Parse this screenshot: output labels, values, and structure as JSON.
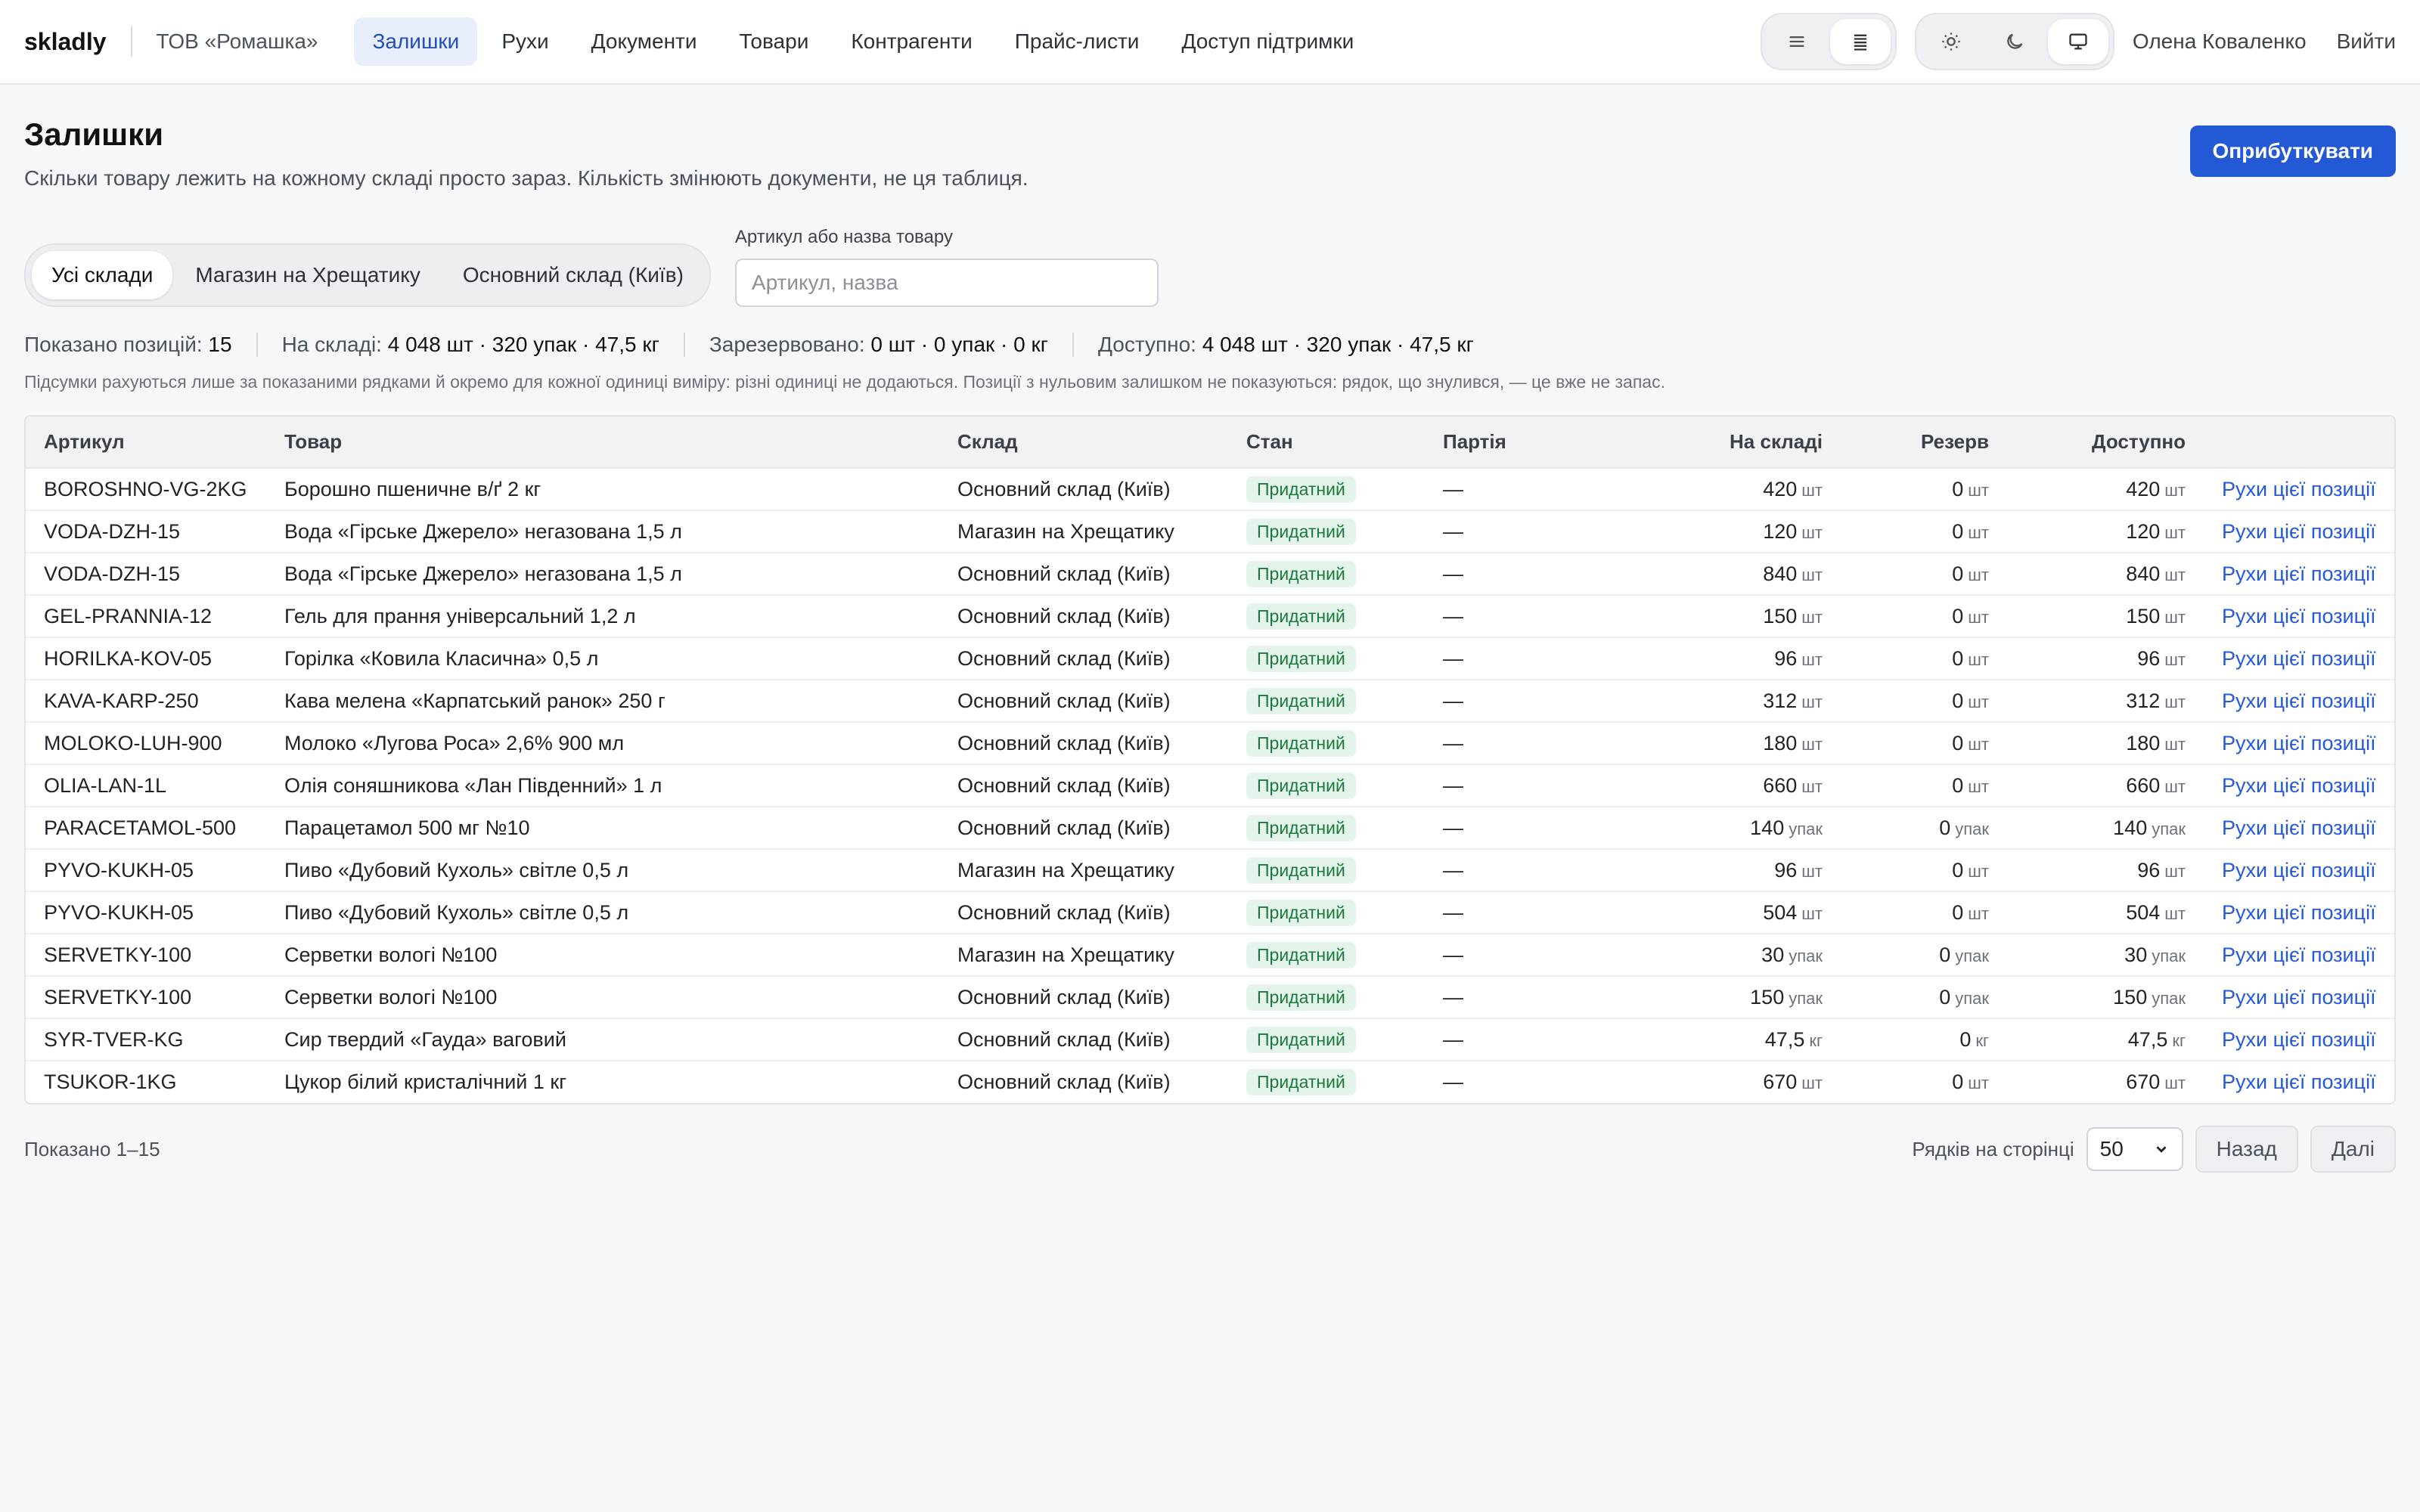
{
  "app": {
    "brand": "skladly",
    "org": "ТОВ «Ромашка»"
  },
  "nav": [
    {
      "label": "Залишки",
      "active": true
    },
    {
      "label": "Рухи"
    },
    {
      "label": "Документи"
    },
    {
      "label": "Товари"
    },
    {
      "label": "Контрагенти"
    },
    {
      "label": "Прайс-листи"
    },
    {
      "label": "Доступ підтримки"
    }
  ],
  "header": {
    "density_options": [
      "list-icon",
      "dense-list-icon"
    ],
    "theme_options": [
      "sun-icon",
      "moon-icon",
      "monitor-icon"
    ],
    "user": "Олена Коваленко",
    "logout": "Вийти"
  },
  "page": {
    "title": "Залишки",
    "subtitle": "Скільки товару лежить на кожному складі просто зараз. Кількість змінюють документи, не ця таблиця.",
    "primary_action": "Оприбуткувати"
  },
  "filters": {
    "warehouses": [
      "Усі склади",
      "Магазин на Хрещатику",
      "Основний склад (Київ)"
    ],
    "search_label": "Артикул або назва товару",
    "search_placeholder": "Артикул, назва",
    "search_value": ""
  },
  "summary": {
    "shown_label": "Показано позицій:",
    "shown_value": "15",
    "stock_label": "На складі:",
    "stock_value": "4 048 шт · 320 упак · 47,5 кг",
    "reserved_label": "Зарезервовано:",
    "reserved_value": "0 шт · 0 упак · 0 кг",
    "available_label": "Доступно:",
    "available_value": "4 048 шт · 320 упак · 47,5 кг",
    "note": "Підсумки рахуються лише за показаними рядками й окремо для кожної одиниці виміру: різні одиниці не додаються. Позиції з нульовим залишком не показуються: рядок, що знулився, — це вже не запас."
  },
  "table": {
    "columns": [
      "Артикул",
      "Товар",
      "Склад",
      "Стан",
      "Партія",
      "На складі",
      "Резерв",
      "Доступно",
      ""
    ],
    "link_label": "Рухи цієї позиції",
    "rows": [
      {
        "sku": "BOROSHNO-VG-2KG",
        "product": "Борошно пшеничне в/ґ 2 кг",
        "warehouse": "Основний склад (Київ)",
        "state": "Придатний",
        "batch": "—",
        "stock": "420",
        "reserve": "0",
        "available": "420",
        "unit": "шт"
      },
      {
        "sku": "VODA-DZH-15",
        "product": "Вода «Гірське Джерело» негазована 1,5 л",
        "warehouse": "Магазин на Хрещатику",
        "state": "Придатний",
        "batch": "—",
        "stock": "120",
        "reserve": "0",
        "available": "120",
        "unit": "шт"
      },
      {
        "sku": "VODA-DZH-15",
        "product": "Вода «Гірське Джерело» негазована 1,5 л",
        "warehouse": "Основний склад (Київ)",
        "state": "Придатний",
        "batch": "—",
        "stock": "840",
        "reserve": "0",
        "available": "840",
        "unit": "шт"
      },
      {
        "sku": "GEL-PRANNIA-12",
        "product": "Гель для прання універсальний 1,2 л",
        "warehouse": "Основний склад (Київ)",
        "state": "Придатний",
        "batch": "—",
        "stock": "150",
        "reserve": "0",
        "available": "150",
        "unit": "шт"
      },
      {
        "sku": "HORILKA-KOV-05",
        "product": "Горілка «Ковила Класична» 0,5 л",
        "warehouse": "Основний склад (Київ)",
        "state": "Придатний",
        "batch": "—",
        "stock": "96",
        "reserve": "0",
        "available": "96",
        "unit": "шт"
      },
      {
        "sku": "KAVA-KARP-250",
        "product": "Кава мелена «Карпатський ранок» 250 г",
        "warehouse": "Основний склад (Київ)",
        "state": "Придатний",
        "batch": "—",
        "stock": "312",
        "reserve": "0",
        "available": "312",
        "unit": "шт"
      },
      {
        "sku": "MOLOKO-LUH-900",
        "product": "Молоко «Лугова Роса» 2,6% 900 мл",
        "warehouse": "Основний склад (Київ)",
        "state": "Придатний",
        "batch": "—",
        "stock": "180",
        "reserve": "0",
        "available": "180",
        "unit": "шт"
      },
      {
        "sku": "OLIA-LAN-1L",
        "product": "Олія соняшникова «Лан Південний» 1 л",
        "warehouse": "Основний склад (Київ)",
        "state": "Придатний",
        "batch": "—",
        "stock": "660",
        "reserve": "0",
        "available": "660",
        "unit": "шт"
      },
      {
        "sku": "PARACETAMOL-500",
        "product": "Парацетамол 500 мг №10",
        "warehouse": "Основний склад (Київ)",
        "state": "Придатний",
        "batch": "—",
        "stock": "140",
        "reserve": "0",
        "available": "140",
        "unit": "упак"
      },
      {
        "sku": "PYVO-KUKH-05",
        "product": "Пиво «Дубовий Кухоль» світле 0,5 л",
        "warehouse": "Магазин на Хрещатику",
        "state": "Придатний",
        "batch": "—",
        "stock": "96",
        "reserve": "0",
        "available": "96",
        "unit": "шт"
      },
      {
        "sku": "PYVO-KUKH-05",
        "product": "Пиво «Дубовий Кухоль» світле 0,5 л",
        "warehouse": "Основний склад (Київ)",
        "state": "Придатний",
        "batch": "—",
        "stock": "504",
        "reserve": "0",
        "available": "504",
        "unit": "шт"
      },
      {
        "sku": "SERVETKY-100",
        "product": "Серветки вологі №100",
        "warehouse": "Магазин на Хрещатику",
        "state": "Придатний",
        "batch": "—",
        "stock": "30",
        "reserve": "0",
        "available": "30",
        "unit": "упак"
      },
      {
        "sku": "SERVETKY-100",
        "product": "Серветки вологі №100",
        "warehouse": "Основний склад (Київ)",
        "state": "Придатний",
        "batch": "—",
        "stock": "150",
        "reserve": "0",
        "available": "150",
        "unit": "упак"
      },
      {
        "sku": "SYR-TVER-KG",
        "product": "Сир твердий «Гауда» ваговий",
        "warehouse": "Основний склад (Київ)",
        "state": "Придатний",
        "batch": "—",
        "stock": "47,5",
        "reserve": "0",
        "available": "47,5",
        "unit": "кг"
      },
      {
        "sku": "TSUKOR-1KG",
        "product": "Цукор білий кристалічний 1 кг",
        "warehouse": "Основний склад (Київ)",
        "state": "Придатний",
        "batch": "—",
        "stock": "670",
        "reserve": "0",
        "available": "670",
        "unit": "шт"
      }
    ]
  },
  "footer": {
    "shown": "Показано 1–15",
    "rows_per_page_label": "Рядків на сторінці",
    "rows_per_page": "50",
    "prev": "Назад",
    "next": "Далі"
  },
  "colors": {
    "accent": "#2459d6",
    "active_nav_bg": "#e8eefb",
    "badge_text": "#1a7a3c",
    "badge_bg": "#e5f4ea"
  }
}
